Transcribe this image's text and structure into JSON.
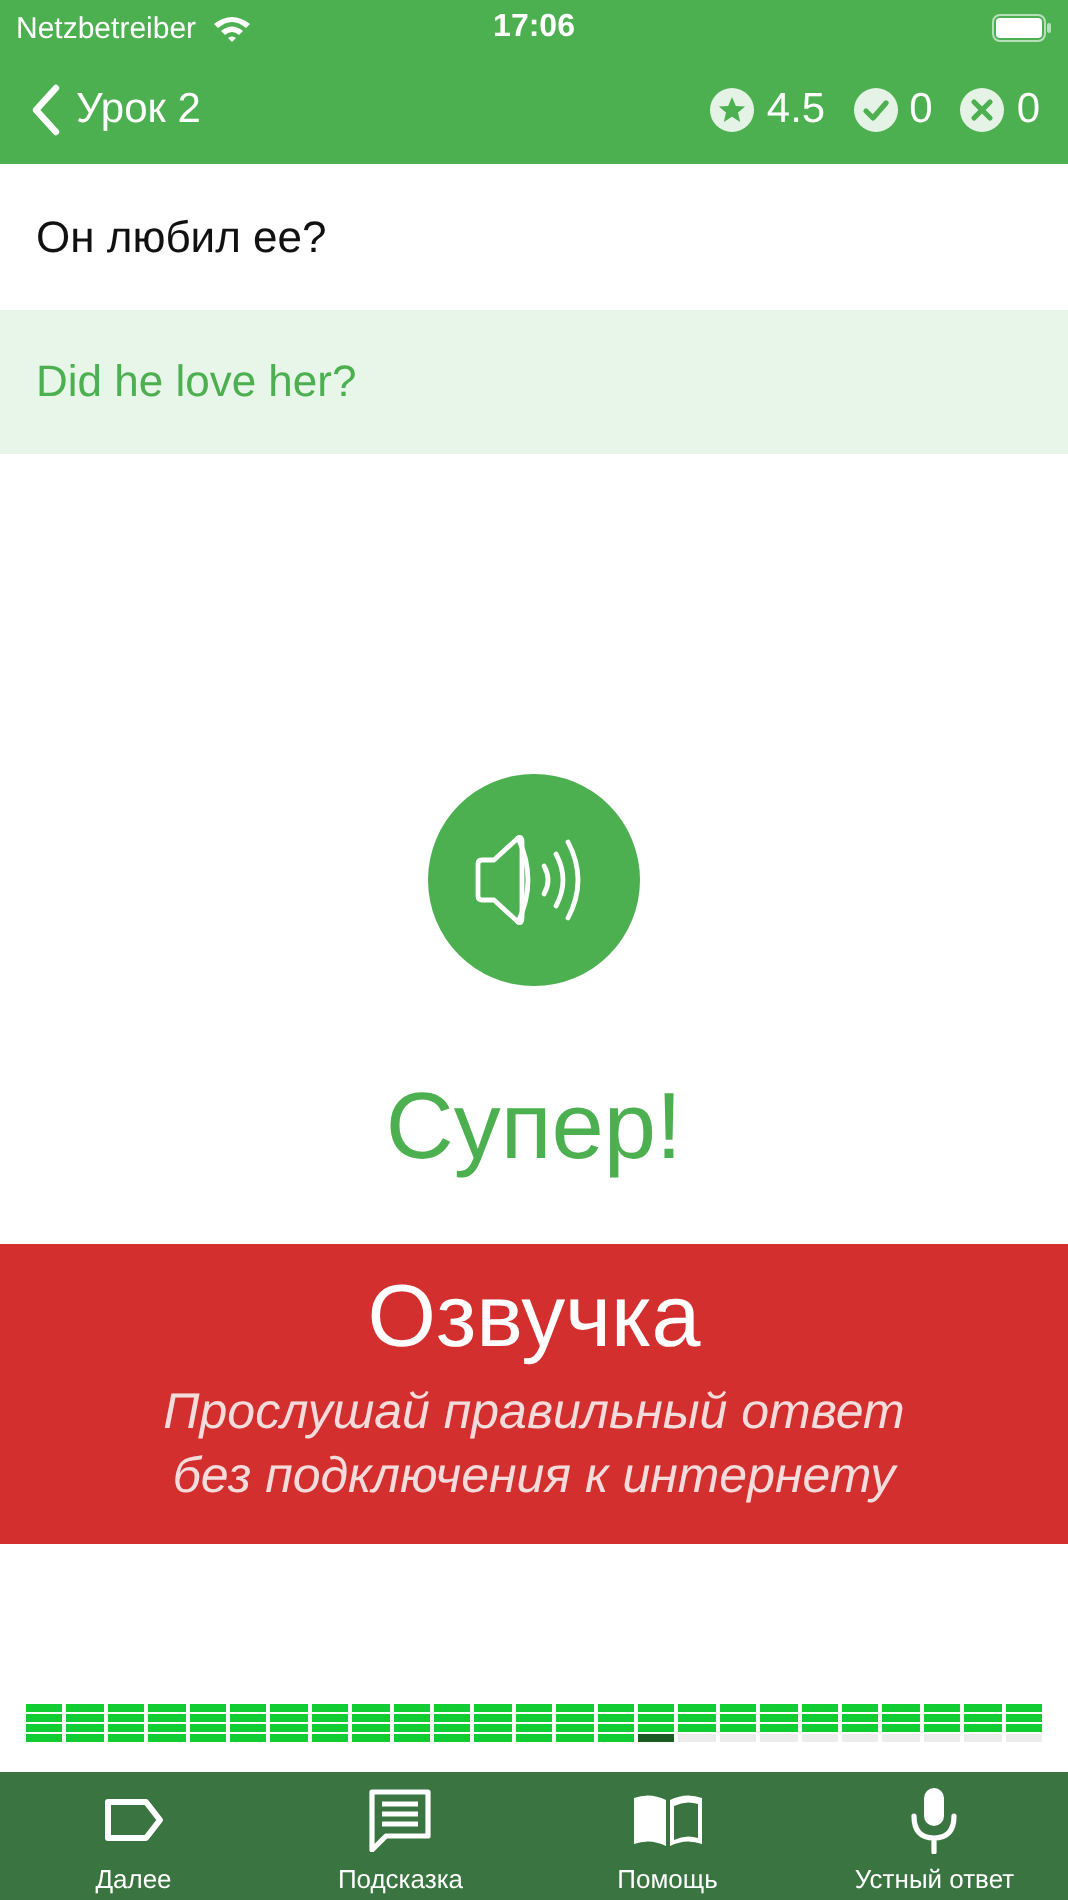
{
  "status_bar": {
    "carrier": "Netzbetreiber",
    "time": "17:06"
  },
  "nav": {
    "back_label": "Урок 2",
    "stats": [
      {
        "kind": "rating",
        "value": "4.5"
      },
      {
        "kind": "correct",
        "value": "0"
      },
      {
        "kind": "wrong",
        "value": "0"
      }
    ]
  },
  "question": "Он любил ее?",
  "answer": "Did he love her?",
  "result": "Супер!",
  "promo": {
    "title": "Озвучка",
    "subtitle_lines": [
      "Прослушай правильный ответ",
      "без подключения к интернету"
    ]
  },
  "progress": {
    "columns": [
      {
        "last_filled": true,
        "current": false
      },
      {
        "last_filled": true,
        "current": false
      },
      {
        "last_filled": true,
        "current": false
      },
      {
        "last_filled": true,
        "current": false
      },
      {
        "last_filled": true,
        "current": false
      },
      {
        "last_filled": true,
        "current": false
      },
      {
        "last_filled": true,
        "current": false
      },
      {
        "last_filled": true,
        "current": false
      },
      {
        "last_filled": true,
        "current": false
      },
      {
        "last_filled": true,
        "current": false
      },
      {
        "last_filled": true,
        "current": false
      },
      {
        "last_filled": true,
        "current": false
      },
      {
        "last_filled": true,
        "current": false
      },
      {
        "last_filled": true,
        "current": false
      },
      {
        "last_filled": true,
        "current": false
      },
      {
        "last_filled": true,
        "current": true
      },
      {
        "last_filled": false,
        "current": false
      },
      {
        "last_filled": false,
        "current": false
      },
      {
        "last_filled": false,
        "current": false
      },
      {
        "last_filled": false,
        "current": false
      },
      {
        "last_filled": false,
        "current": false
      },
      {
        "last_filled": false,
        "current": false
      },
      {
        "last_filled": false,
        "current": false
      },
      {
        "last_filled": false,
        "current": false
      },
      {
        "last_filled": false,
        "current": false
      }
    ]
  },
  "tab_bar": [
    {
      "kind": "next",
      "label": "Далее"
    },
    {
      "kind": "hint",
      "label": "Подсказка"
    },
    {
      "kind": "help",
      "label": "Помощь"
    },
    {
      "kind": "voice",
      "label": "Устный ответ"
    }
  ]
}
